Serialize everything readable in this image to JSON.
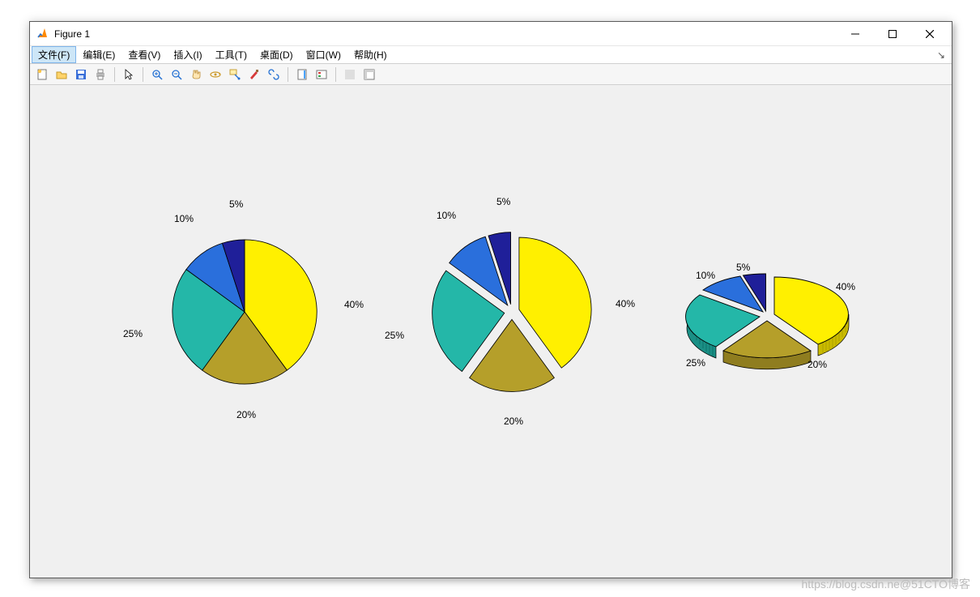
{
  "window": {
    "title": "Figure 1"
  },
  "menu": {
    "items": [
      "文件(F)",
      "编辑(E)",
      "查看(V)",
      "插入(I)",
      "工具(T)",
      "桌面(D)",
      "窗口(W)",
      "帮助(H)"
    ],
    "activeIndex": 0
  },
  "toolbar": {
    "icons": [
      "new-figure",
      "open",
      "save",
      "print",
      "pointer",
      "zoom-in",
      "zoom-out",
      "pan",
      "rotate3d",
      "data-cursor",
      "brush",
      "link-axes",
      "insert-colorbar",
      "insert-legend",
      "hide-plot-tools",
      "show-plot-tools"
    ]
  },
  "watermark": "https://blog.csdn.ne@51CTO博客",
  "colors": {
    "slice1": "#fff000",
    "slice2": "#b59f2a",
    "slice3": "#24b7a8",
    "slice4": "#2a6fdc",
    "slice5": "#1f1f99"
  },
  "chart_data": [
    {
      "type": "pie",
      "style": "2d",
      "exploded": false,
      "values": [
        40,
        20,
        25,
        10,
        5
      ],
      "labels": [
        "40%",
        "20%",
        "25%",
        "10%",
        "5%"
      ]
    },
    {
      "type": "pie",
      "style": "2d",
      "exploded": true,
      "values": [
        40,
        20,
        25,
        10,
        5
      ],
      "labels": [
        "40%",
        "20%",
        "25%",
        "10%",
        "5%"
      ]
    },
    {
      "type": "pie",
      "style": "3d",
      "exploded": true,
      "values": [
        40,
        20,
        25,
        10,
        5
      ],
      "labels": [
        "40%",
        "20%",
        "25%",
        "10%",
        "5%"
      ]
    }
  ],
  "pielabels": {
    "p1": {
      "l40": "40%",
      "l20": "20%",
      "l25": "25%",
      "l10": "10%",
      "l5": "5%"
    },
    "p2": {
      "l40": "40%",
      "l20": "20%",
      "l25": "25%",
      "l10": "10%",
      "l5": "5%"
    },
    "p3": {
      "l40": "40%",
      "l20": "20%",
      "l25": "25%",
      "l10": "10%",
      "l5": "5%"
    }
  }
}
